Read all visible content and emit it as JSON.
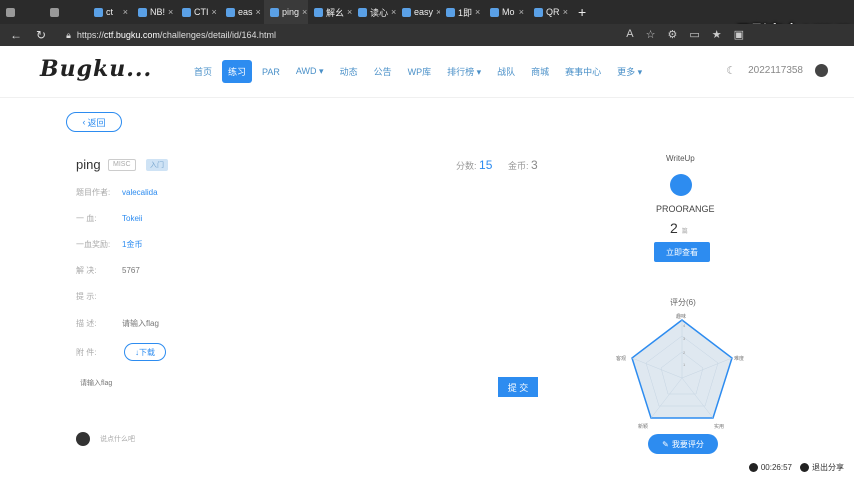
{
  "browser": {
    "tabs": [
      {
        "label": ""
      },
      {
        "label": ""
      },
      {
        "label": "ct"
      },
      {
        "label": "NB!"
      },
      {
        "label": "CTI"
      },
      {
        "label": "eas"
      },
      {
        "label": "ping"
      },
      {
        "label": "解幺"
      },
      {
        "label": "读心"
      },
      {
        "label": "easy"
      },
      {
        "label": "1即"
      },
      {
        "label": "Mo"
      },
      {
        "label": "QR"
      }
    ],
    "url_prefix": "https://",
    "url_host": "ctf.bugku.com",
    "url_path": "/challenges/detail/id/164.html",
    "watermark": "云影安全 bilibili"
  },
  "nav": {
    "logo": "Bugku...",
    "items": [
      "首页",
      "练习",
      "PAR",
      "AWD ▾",
      "动态",
      "公告",
      "WP库",
      "排行榜 ▾",
      "战队",
      "商城",
      "赛事中心",
      "更多 ▾"
    ],
    "user": "2022117358"
  },
  "challenge": {
    "back_label": "返回",
    "title": "ping",
    "tag_category": "MISC",
    "tag_level": "入门",
    "score_label": "分数:",
    "score_value": "15",
    "gold_label": "金币:",
    "gold_value": "3",
    "author_label": "题目作者:",
    "author": "valecalida",
    "first_blood_label": "一    血:",
    "first_blood": "Tokeii",
    "reward_label": "一血奖励:",
    "reward": "1金币",
    "solves_label": "解    决:",
    "solves": "5767",
    "hint_label": "提    示:",
    "hint": "",
    "desc_label": "描    述:",
    "desc": "请输入flag",
    "attach_label": "附    件:",
    "download_label": "↓下载",
    "flag_placeholder": "请输入flag",
    "submit_label": "提 交",
    "comment_placeholder": "说点什么吧"
  },
  "writeup": {
    "title": "WriteUp",
    "author": "PROORANGE",
    "count": "2",
    "count_unit": "篇",
    "view_label": "立即查看"
  },
  "rating": {
    "title": "评分(6)",
    "axes": [
      "趣味",
      "难度",
      "实用",
      "新颖",
      "客观"
    ],
    "ticks": [
      "1",
      "2",
      "3",
      "4"
    ],
    "rate_label": "我要评分"
  },
  "status": {
    "timer": "00:26:57",
    "exit_label": "退出分享"
  }
}
